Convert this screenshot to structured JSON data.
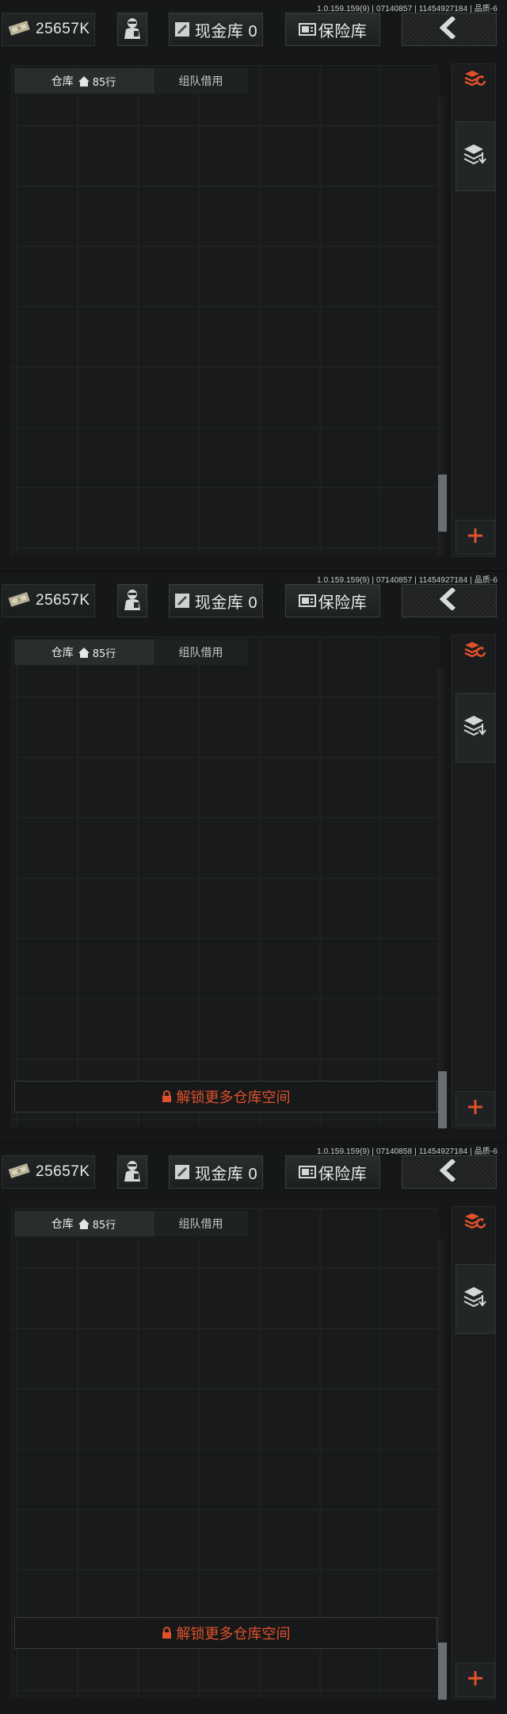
{
  "colors": {
    "accent": "#e0512b",
    "background": "#151718",
    "grid_line": "#232627"
  },
  "frames": [
    {
      "version": "1.0.159.159(9) | 07140857 | 11454927184 | 品质-6",
      "money": {
        "icon": "cash-icon",
        "value": "25657K"
      },
      "cash_vault": {
        "label": "现金库 0"
      },
      "safe": {
        "label": "保险库"
      },
      "tabs": {
        "warehouse": "仓库",
        "rows": "85行",
        "team_borrow": "组队借用"
      },
      "unlock": null,
      "scroll_position": 0.85
    },
    {
      "version": "1.0.159.159(9) | 07140857 | 11454927184 | 品质-6",
      "money": {
        "icon": "cash-icon",
        "value": "25657K"
      },
      "cash_vault": {
        "label": "现金库 0"
      },
      "safe": {
        "label": "保险库"
      },
      "tabs": {
        "warehouse": "仓库",
        "rows": "85行",
        "team_borrow": "组队借用"
      },
      "unlock": "解锁更多仓库空间",
      "scroll_position": 1.0
    },
    {
      "version": "1.0.159.159(9) | 07140858 | 11454927184 | 品质-6",
      "money": {
        "icon": "cash-icon",
        "value": "25657K"
      },
      "cash_vault": {
        "label": "现金库 0"
      },
      "safe": {
        "label": "保险库"
      },
      "tabs": {
        "warehouse": "仓库",
        "rows": "85行",
        "team_borrow": "组队借用"
      },
      "unlock": "解锁更多仓库空间",
      "scroll_position": 1.0
    }
  ]
}
